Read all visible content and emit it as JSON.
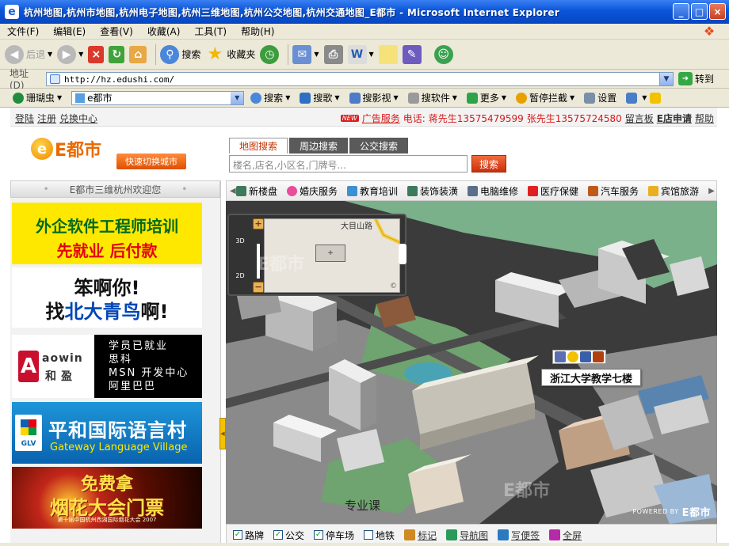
{
  "window": {
    "title": "杭州地图,杭州市地图,杭州电子地图,杭州三维地图,杭州公交地图,杭州交通地图_E都市 - Microsoft Internet Explorer",
    "controls": [
      "_",
      "□",
      "×"
    ]
  },
  "menubar": {
    "items": [
      "文件(F)",
      "编辑(E)",
      "查看(V)",
      "收藏(A)",
      "工具(T)",
      "帮助(H)"
    ]
  },
  "toolbar": {
    "back": "后退",
    "search": "搜索",
    "favorites": "收藏夹"
  },
  "address": {
    "label": "地址(D)",
    "url": "http://hz.edushi.com/",
    "go": "转到"
  },
  "linkbar": {
    "brand": "珊瑚虫",
    "combo_value": "e都市",
    "items": [
      "搜索",
      "搜歌",
      "搜影视",
      "搜软件",
      "更多",
      "暂停拦截",
      "设置"
    ]
  },
  "site": {
    "topbar": {
      "left_links": [
        "登陆",
        "注册",
        "兑换中心"
      ],
      "new_badge": "NEW",
      "ad_service": "广告服务",
      "phone_label": "电话:",
      "contact1": "蒋先生13575479599",
      "contact2": "张先生13575724580",
      "message": "留言板",
      "store_apply": "E店申请",
      "help": "帮助"
    },
    "logo_text": "E都市",
    "switch_city": "快速切换城市",
    "search_tabs": [
      "地图搜索",
      "周边搜索",
      "公交搜索"
    ],
    "search_placeholder": "楼名,店名,小区名,门牌号...",
    "search_button": "搜索",
    "welcome": "E都市三维杭州欢迎您",
    "categories": [
      "新楼盘",
      "婚庆服务",
      "教育培训",
      "装饰装潢",
      "电脑维修",
      "医疗保健",
      "汽车服务",
      "宾馆旅游"
    ]
  },
  "ads": {
    "ad1": {
      "line1": "外企软件工程师培训",
      "line2": "先就业 后付款"
    },
    "ad2": {
      "line1": "笨啊你!",
      "line2_prefix": "找",
      "line2_bold": "北大青鸟",
      "line2_suffix": "啊!"
    },
    "ad3": {
      "brand": "aowin",
      "brand_cn": "和盈",
      "lines": [
        "学员已就业",
        "思科",
        "MSN 开发中心",
        "阿里巴巴"
      ]
    },
    "ad4": {
      "logo": "GLV",
      "cn": "平和国际语言村",
      "en": "Gateway Language Village"
    },
    "ad5": {
      "line1": "免费拿",
      "line2": "烟花大会门票",
      "line3": "第十届中国杭州西湖国际烟花大会 2007"
    }
  },
  "map": {
    "mode_3d": "3D",
    "mode_2d": "2D",
    "overview_plus": "+",
    "overview_road": "大目山路",
    "tooltip": "浙江大学教学七楼",
    "watermark": "E都市",
    "label_bottom": "专业课",
    "powered_by": "POWERED BY",
    "powered_brand": "E都市"
  },
  "bottom_controls": [
    {
      "label": "路牌",
      "checked": true
    },
    {
      "label": "公交",
      "checked": true
    },
    {
      "label": "停车场",
      "checked": true
    },
    {
      "label": "地铁",
      "checked": false
    }
  ],
  "bottom_tools": [
    "标记",
    "导航图",
    "写便签",
    "全屏"
  ]
}
